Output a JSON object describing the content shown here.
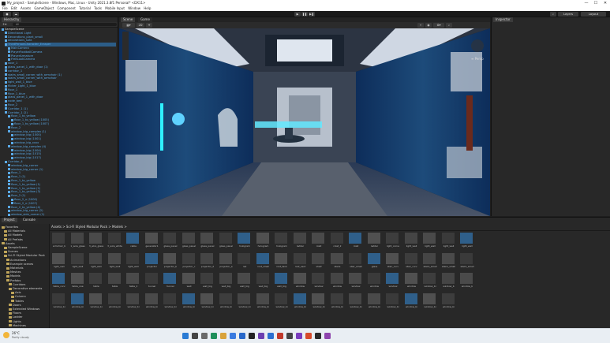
{
  "window": {
    "title": "My_project - SampleScene - Windows, Mac, Linux - Unity 2021.3.8f1 Personal* <DX11>",
    "controls": [
      "—",
      "☐",
      "✕"
    ]
  },
  "menu": [
    "File",
    "Edit",
    "Assets",
    "GameObject",
    "Component",
    "Tutorial",
    "Tools",
    "Mobile Input",
    "Window",
    "Help"
  ],
  "toolbar": {
    "layers_label": "Layers",
    "layout_label": "Layout"
  },
  "hierarchy": {
    "tab": "Hierarchy",
    "search_placeholder": "All",
    "rows": [
      {
        "t": "SampleScene",
        "d": 0,
        "w": true
      },
      {
        "t": "Directional Light",
        "d": 1,
        "w": false
      },
      {
        "t": "Decorations_plant_small",
        "d": 1,
        "w": false
      },
      {
        "t": "decorations_sofa",
        "d": 1,
        "w": false
      },
      {
        "t": "ThirdPersonCharacter_Erasper",
        "d": 1,
        "w": false,
        "s": true
      },
      {
        "t": "MainCamera",
        "d": 2,
        "w": false
      },
      {
        "t": "PlayerFootballCamera",
        "d": 2,
        "w": false
      },
      {
        "t": "PlayerArmature",
        "d": 2,
        "w": false
      },
      {
        "t": "FreeLookCamera",
        "d": 2,
        "w": false
      },
      {
        "t": "door_1",
        "d": 1,
        "w": false
      },
      {
        "t": "glass_panel_1_with_door (1)",
        "d": 1,
        "w": false
      },
      {
        "t": "corridor_1",
        "d": 1,
        "w": false
      },
      {
        "t": "stairs_small_corner_with_armchair (1)",
        "d": 1,
        "w": false
      },
      {
        "t": "stairs_small_corner_with_armchair",
        "d": 1,
        "w": false
      },
      {
        "t": "light_wall_1_blue",
        "d": 1,
        "w": false
      },
      {
        "t": "flicker_Light_1_blue",
        "d": 1,
        "w": false
      },
      {
        "t": "floor_1",
        "d": 1,
        "w": false
      },
      {
        "t": "floor_1_blue",
        "d": 1,
        "w": false
      },
      {
        "t": "glass_panel_1_with_door",
        "d": 1,
        "w": false
      },
      {
        "t": "node_bed",
        "d": 1,
        "w": false
      },
      {
        "t": "floor_2",
        "d": 1,
        "w": false
      },
      {
        "t": "Corridor_1 (1)",
        "d": 1,
        "w": false
      },
      {
        "t": "Corridor_1 (2)",
        "d": 1,
        "w": false
      },
      {
        "t": "floor_1_to_yellow",
        "d": 2,
        "w": false
      },
      {
        "t": "floor_1_to_yellow (1005)",
        "d": 3,
        "w": false
      },
      {
        "t": "floor_1_to_yellow (1007)",
        "d": 3,
        "w": false
      },
      {
        "t": "floor_2",
        "d": 2,
        "w": false
      },
      {
        "t": "window_big_complex (1)",
        "d": 2,
        "w": false
      },
      {
        "t": "window_big (1000)",
        "d": 3,
        "w": false
      },
      {
        "t": "window_big (1001)",
        "d": 3,
        "w": false
      },
      {
        "t": "window_big_xxxx",
        "d": 3,
        "w": false
      },
      {
        "t": "window_big_complex (4)",
        "d": 2,
        "w": false
      },
      {
        "t": "window_big (1004)",
        "d": 3,
        "w": false
      },
      {
        "t": "window_big (1015)",
        "d": 3,
        "w": false
      },
      {
        "t": "window_big (1017)",
        "d": 3,
        "w": false
      },
      {
        "t": "Corridor_4",
        "d": 1,
        "w": false
      },
      {
        "t": "window_big_corner",
        "d": 2,
        "w": false
      },
      {
        "t": "window_big_corner (1)",
        "d": 2,
        "w": false
      },
      {
        "t": "floor_1",
        "d": 2,
        "w": false
      },
      {
        "t": "floor_1 (1)",
        "d": 2,
        "w": false
      },
      {
        "t": "floor_1_to_yellow",
        "d": 2,
        "w": false
      },
      {
        "t": "floor_1_to_yellow (1)",
        "d": 2,
        "w": false
      },
      {
        "t": "floor_1_to_yellow (2)",
        "d": 2,
        "w": false
      },
      {
        "t": "floor_1_to_yellow (3)",
        "d": 2,
        "w": false
      },
      {
        "t": "floor_2 (1)",
        "d": 2,
        "w": false
      },
      {
        "t": "floor_2_x (1000)",
        "d": 3,
        "w": false
      },
      {
        "t": "floor_2_x (1007)",
        "d": 3,
        "w": false
      },
      {
        "t": "floor_2_to_yellow (4)",
        "d": 2,
        "w": false
      },
      {
        "t": "window_big_corner (2)",
        "d": 2,
        "w": false
      },
      {
        "t": "window_side_corner (1)",
        "d": 2,
        "w": false
      }
    ]
  },
  "scene": {
    "tabs": [
      "Scene",
      "Game"
    ],
    "gizmo_label": "≡ Persp"
  },
  "inspector": {
    "tab": "Inspector"
  },
  "project": {
    "tabs": [
      "Project",
      "Console"
    ],
    "breadcrumb": "Assets > Sci-Fi Styled Modular Pack > Models >",
    "tree": [
      {
        "t": "Favorites",
        "d": 0
      },
      {
        "t": "All Materials",
        "d": 1
      },
      {
        "t": "All Models",
        "d": 1
      },
      {
        "t": "All Prefabs",
        "d": 1
      },
      {
        "t": "Assets",
        "d": 0
      },
      {
        "t": "SampleScene",
        "d": 1
      },
      {
        "t": "Scenes",
        "d": 1
      },
      {
        "t": "Sci-Fi Styled Modular Pack",
        "d": 1
      },
      {
        "t": "Animations",
        "d": 2
      },
      {
        "t": "Example scenes",
        "d": 2
      },
      {
        "t": "Materials",
        "d": 2
      },
      {
        "t": "Meshes",
        "d": 2
      },
      {
        "t": "Models",
        "d": 2
      },
      {
        "t": "Prefabs",
        "d": 2
      },
      {
        "t": "Corridors",
        "d": 3
      },
      {
        "t": "Decorative elements",
        "d": 3
      },
      {
        "t": "Axis",
        "d": 4
      },
      {
        "t": "Column",
        "d": 4
      },
      {
        "t": "Tables",
        "d": 4
      },
      {
        "t": "Doors",
        "d": 3
      },
      {
        "t": "Extended Windows",
        "d": 3
      },
      {
        "t": "Floors",
        "d": 3
      },
      {
        "t": "Ladder",
        "d": 3
      },
      {
        "t": "Lights",
        "d": 3
      },
      {
        "t": "Machines",
        "d": 3
      }
    ],
    "assets": [
      "armchair_b",
      "1_wire_glass",
      "3_wire_glass",
      "3_wire_white",
      "cable",
      "generator1",
      "glass_panel",
      "glass_panel",
      "glass_panel",
      "glass_panel",
      "hologram",
      "hologram",
      "hologram",
      "ladder",
      "rolet",
      "rolet_2",
      "rolet",
      "ladder",
      "light_corne",
      "light_wall",
      "light_wall",
      "light_wall",
      "light_wall",
      "light_ceili",
      "light_wall",
      "light_wall",
      "light_wall",
      "light_wall",
      "projector",
      "projector_b",
      "projector_c",
      "projector_d",
      "projector_e",
      "rail",
      "roof_small",
      "roof_tank",
      "roof_vent",
      "shelf",
      "stairs",
      "stair_small",
      "glass",
      "stair_curv",
      "stair_curv",
      "stairs_small",
      "stairs_small",
      "stairs_small",
      "table_curv",
      "table_one",
      "table",
      "table",
      "table_2",
      "tunnel",
      "tunnel",
      "wall",
      "wall_big",
      "wall_big",
      "wall_big",
      "wall_big",
      "wall_big",
      "window",
      "window",
      "window",
      "window",
      "window",
      "window",
      "window",
      "window_bi",
      "window_b",
      "window_b",
      "window_bi",
      "window_bi",
      "window_bi",
      "window_bi",
      "window_bi",
      "window_bi",
      "window_bi",
      "window_bi",
      "window_bi",
      "window_bi",
      "window_bi",
      "window_bi",
      "window_bi",
      "window_bi",
      "window_bi",
      "window_bi",
      "window_bi",
      "window_bi",
      "window_bi",
      "window_bi",
      "window_bi",
      "window_bi"
    ]
  },
  "taskbar": {
    "temp": "26°C",
    "weather": "Partly cloudy"
  },
  "colors": {
    "accent_blue": "#5aa9e6",
    "selection": "#2c5d87",
    "panel_bg": "#282828"
  }
}
